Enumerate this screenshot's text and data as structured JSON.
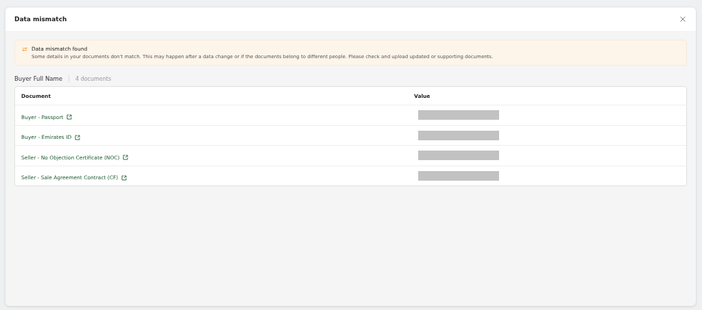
{
  "dialog": {
    "title": "Data mismatch"
  },
  "alert": {
    "title": "Data mismatch found",
    "message": "Some details in your documents don't match. This may happen after a data change or if the documents belong to different people. Please check and upload updated or supporting documents."
  },
  "section": {
    "title": "Buyer Full Name",
    "count": "4 documents"
  },
  "table": {
    "columns": [
      "Document",
      "Value"
    ],
    "rows": [
      {
        "document": "Buyer - Passport",
        "kind": "redacted"
      },
      {
        "document": "Buyer - Emirates ID",
        "kind": "redacted"
      },
      {
        "document": "Seller - No Objection Certificate (NOC)",
        "kind": "redacted"
      },
      {
        "document": "Seller - Sale Agreement Contract (CF)",
        "kind": "redacted"
      }
    ]
  }
}
